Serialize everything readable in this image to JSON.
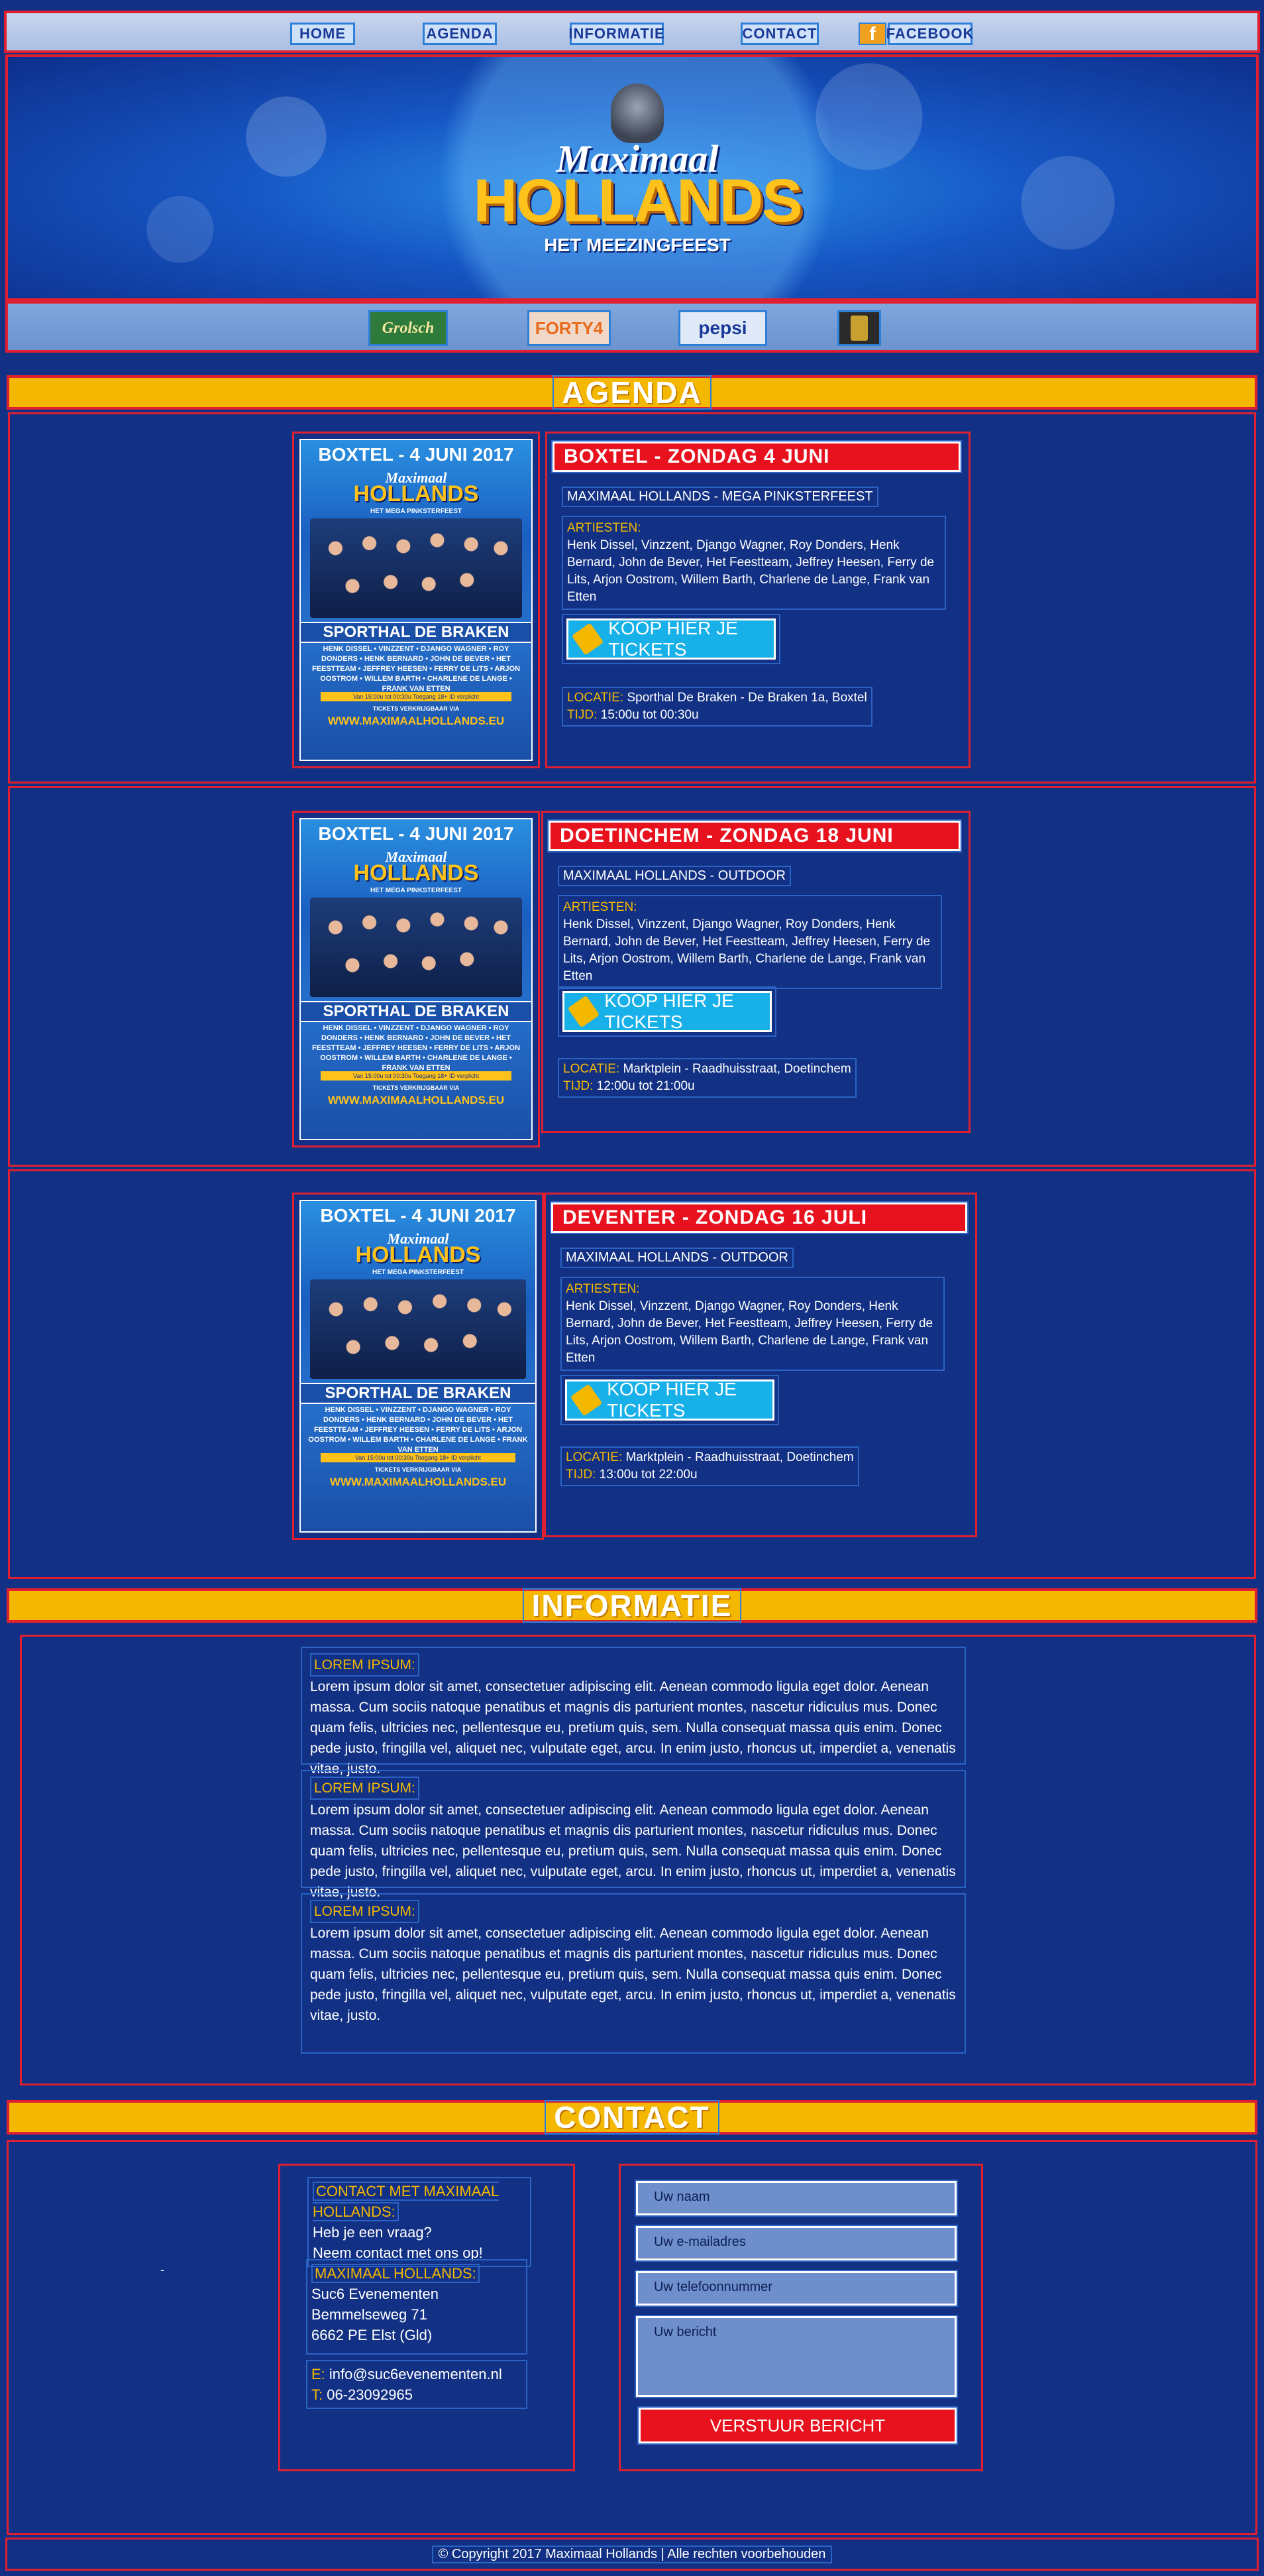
{
  "nav": {
    "items": [
      {
        "label": "HOME"
      },
      {
        "label": "AGENDA"
      },
      {
        "label": "INFORMATIE"
      },
      {
        "label": "CONTACT"
      },
      {
        "label": "FACEBOOK",
        "icon": "facebook-icon"
      }
    ]
  },
  "hero": {
    "logo_top": "Maximaal",
    "logo_main": "HOLLANDS",
    "logo_sub": "HET MEEZINGFEEST"
  },
  "sponsors": [
    "Grolsch",
    "FORTY4",
    "pepsi",
    "sponsor-badge"
  ],
  "agenda": {
    "title": "AGENDA",
    "poster": {
      "date": "BOXTEL - 4 JUNI 2017",
      "logo_top": "Maximaal",
      "logo_main": "HOLLANDS",
      "logo_sub": "HET MEGA PINKSTERFEEST",
      "venue": "SPORTHAL DE BRAKEN",
      "names": "HENK DISSEL • VINZZENT • DJANGO WAGNER • ROY DONDERS • HENK BERNARD • JOHN DE BEVER • HET FEESTTEAM • JEFFREY HEESEN • FERRY DE LITS • ARJON OOSTROM • WILLEM BARTH • CHARLENE DE LANGE • FRANK VAN ETTEN",
      "bar": "Van 15:00u tot 00:30u   Toegang 18+   ID verplicht",
      "tickets": "TICKETS VERKRIJGBAAR VIA",
      "url": "WWW.MAXIMAALHOLLANDS.EU"
    },
    "events": [
      {
        "title": "BOXTEL - ZONDAG 4 JUNI",
        "subtitle": "MAXIMAAL HOLLANDS - MEGA PINKSTERFEEST",
        "artists_label": "ARTIESTEN:",
        "artists": "Henk Dissel, Vinzzent, Django Wagner, Roy Donders, Henk Bernard, John de Bever, Het Feestteam, Jeffrey Heesen, Ferry de Lits, Arjon Oostrom, Willem Barth, Charlene de Lange, Frank van Etten",
        "ticket_label": "KOOP HIER JE TICKETS",
        "location_label": "LOCATIE:",
        "location": "Sporthal De Braken - De Braken 1a, Boxtel",
        "time_label": "TIJD:",
        "time": "15:00u tot 00:30u"
      },
      {
        "title": "DOETINCHEM - ZONDAG 18 JUNI",
        "subtitle": "MAXIMAAL HOLLANDS - OUTDOOR",
        "artists_label": "ARTIESTEN:",
        "artists": "Henk Dissel, Vinzzent, Django Wagner, Roy Donders, Henk Bernard, John de Bever, Het Feestteam, Jeffrey Heesen, Ferry de Lits, Arjon Oostrom, Willem Barth, Charlene de Lange, Frank van Etten",
        "ticket_label": "KOOP HIER JE TICKETS",
        "location_label": "LOCATIE:",
        "location": "Marktplein - Raadhuisstraat, Doetinchem",
        "time_label": "TIJD:",
        "time": "12:00u tot 21:00u"
      },
      {
        "title": "DEVENTER - ZONDAG 16 JULI",
        "subtitle": "MAXIMAAL HOLLANDS - OUTDOOR",
        "artists_label": "ARTIESTEN:",
        "artists": "Henk Dissel, Vinzzent, Django Wagner, Roy Donders, Henk Bernard, John de Bever, Het Feestteam, Jeffrey Heesen, Ferry de Lits, Arjon Oostrom, Willem Barth, Charlene de Lange, Frank van Etten",
        "ticket_label": "KOOP HIER JE TICKETS",
        "location_label": "LOCATIE:",
        "location": "Marktplein - Raadhuisstraat, Doetinchem",
        "time_label": "TIJD:",
        "time": "13:00u tot 22:00u"
      }
    ]
  },
  "informatie": {
    "title": "INFORMATIE",
    "items": [
      {
        "label": "LOREM IPSUM:",
        "text": "Lorem ipsum dolor sit amet, consectetuer adipiscing elit. Aenean commodo ligula eget dolor. Aenean massa. Cum sociis natoque penatibus et magnis dis parturient montes, nascetur ridiculus mus. Donec quam felis, ultricies nec, pellentesque eu, pretium quis, sem. Nulla consequat massa quis enim. Donec pede justo, fringilla vel, aliquet nec, vulputate eget, arcu. In enim justo, rhoncus ut, imperdiet a, venenatis vitae, justo."
      },
      {
        "label": "LOREM IPSUM:",
        "text": "Lorem ipsum dolor sit amet, consectetuer adipiscing elit. Aenean commodo ligula eget dolor. Aenean massa. Cum sociis natoque penatibus et magnis dis parturient montes, nascetur ridiculus mus. Donec quam felis, ultricies nec, pellentesque eu, pretium quis, sem. Nulla consequat massa quis enim. Donec pede justo, fringilla vel, aliquet nec, vulputate eget, arcu. In enim justo, rhoncus ut, imperdiet a, venenatis vitae, justo."
      },
      {
        "label": "LOREM IPSUM:",
        "text": "Lorem ipsum dolor sit amet, consectetuer adipiscing elit. Aenean commodo ligula eget dolor. Aenean massa. Cum sociis natoque penatibus et magnis dis parturient montes, nascetur ridiculus mus. Donec quam felis, ultricies nec, pellentesque eu, pretium quis, sem. Nulla consequat massa quis enim. Donec pede justo, fringilla vel, aliquet nec, vulputate eget, arcu. In enim justo, rhoncus ut, imperdiet a, venenatis vitae, justo."
      }
    ]
  },
  "contact": {
    "title": "CONTACT",
    "intro_label": "CONTACT MET MAXIMAAL HOLLANDS:",
    "intro_line1": "Heb je een vraag?",
    "intro_line2": "Neem contact met ons op!",
    "address_label": "MAXIMAAL HOLLANDS:",
    "address_line1": "Suc6 Evenementen",
    "address_line2": "Bemmelseweg 71",
    "address_line3": "6662 PE Elst (Gld)",
    "email_label": "E:",
    "email": "info@suc6evenementen.nl",
    "phone_label": "T:",
    "phone": "06-23092965",
    "stray": "-",
    "form": {
      "name_placeholder": "Uw naam",
      "email_placeholder": "Uw e-mailadres",
      "phone_placeholder": "Uw telefoonnummer",
      "message_placeholder": "Uw bericht",
      "submit_label": "VERSTUUR BERICHT"
    }
  },
  "footer": {
    "copyright": "© Copyright 2017 Maximaal Hollands | Alle rechten voorbehouden"
  }
}
